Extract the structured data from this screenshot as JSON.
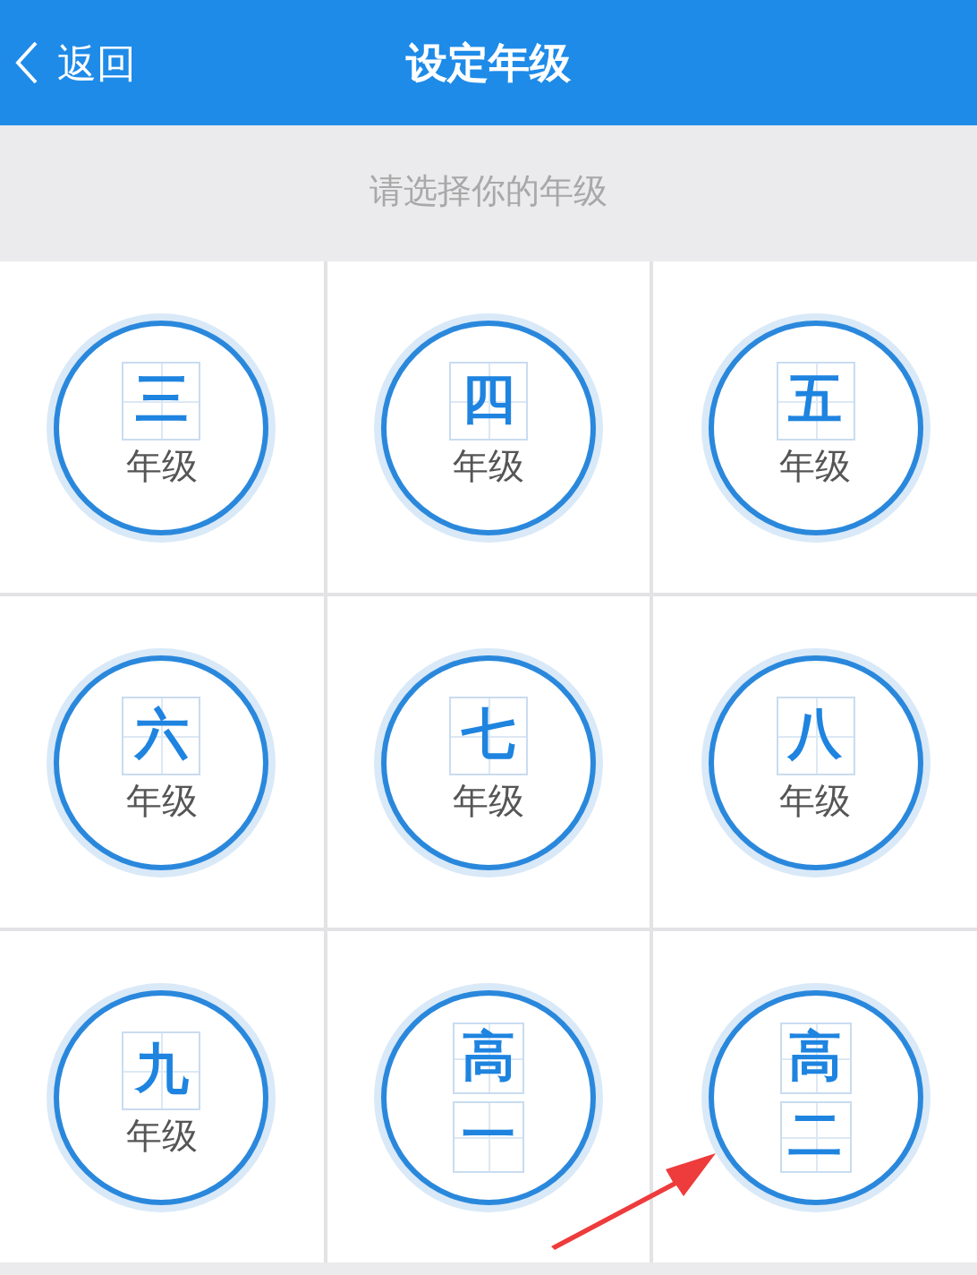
{
  "header": {
    "back": "返回",
    "title": "设定年级"
  },
  "prompt": "请选择你的年级",
  "grades": [
    {
      "kind": "labeled",
      "glyphs": [
        "三"
      ],
      "label": "年级"
    },
    {
      "kind": "labeled",
      "glyphs": [
        "四"
      ],
      "label": "年级"
    },
    {
      "kind": "labeled",
      "glyphs": [
        "五"
      ],
      "label": "年级"
    },
    {
      "kind": "labeled",
      "glyphs": [
        "六"
      ],
      "label": "年级"
    },
    {
      "kind": "labeled",
      "glyphs": [
        "七"
      ],
      "label": "年级"
    },
    {
      "kind": "labeled",
      "glyphs": [
        "八"
      ],
      "label": "年级"
    },
    {
      "kind": "labeled",
      "glyphs": [
        "九"
      ],
      "label": "年级"
    },
    {
      "kind": "stacked",
      "glyphs": [
        "高",
        "一"
      ]
    },
    {
      "kind": "stacked",
      "glyphs": [
        "高",
        "二"
      ]
    }
  ]
}
